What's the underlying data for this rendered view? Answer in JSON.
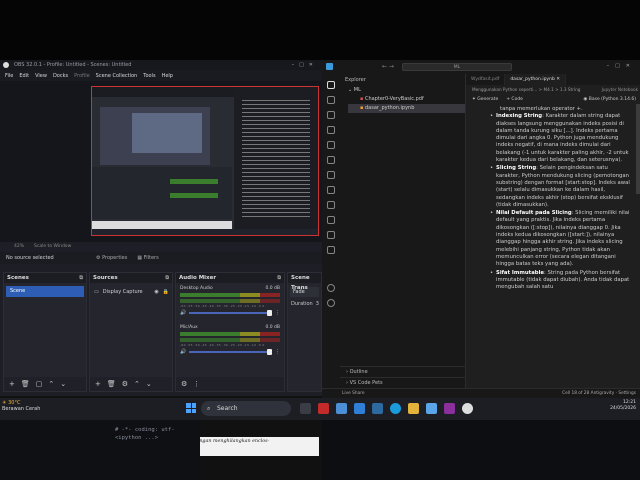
{
  "obs": {
    "title": "OBS 32.0.1 - Profile: Untitled - Scenes: Untitled",
    "menu": [
      "File",
      "Edit",
      "View",
      "Docks",
      "Profile",
      "Scene Collection",
      "Tools",
      "Help"
    ],
    "zoom": "42%",
    "scale_mode": "Scale to Window",
    "no_source": "No source selected",
    "properties_label": "Properties",
    "filters_label": "Filters",
    "docks": {
      "scenes_title": "Scenes",
      "scene_item": "Scene",
      "sources_title": "Sources",
      "source_item": "Display Capture",
      "mixer_title": "Audio Mixer",
      "channels": [
        {
          "name": "Desktop Audio",
          "db": "0.0 dB"
        },
        {
          "name": "Mic/Aux",
          "db": "0.0 dB"
        }
      ],
      "meter_ticks": "-60 -55 -50 -45 -40 -35 -30 -25 -20 -15 -10 -5 0",
      "transitions_title": "Scene Trans",
      "transition": "Fade",
      "duration_label": "Duration",
      "duration_value": "3"
    },
    "subtitle_line1": "Fungsi print() menghasilkan output yang lebih dapat terbaca dengan menghilangkan enclos-",
    "subtitle_line2": "ing quotes dan mencetak escaped and special character."
  },
  "code_strip": {
    "line1": "# -*- coding: utf-",
    "line2": "<ipython ...>"
  },
  "taskbar": {
    "weather_temp": "30°C",
    "weather_desc": "Berawan Cerah",
    "search_placeholder": "Search",
    "clock_time": "12:21",
    "clock_date": "24/05/2026"
  },
  "vscode": {
    "search_text": "ML",
    "explorer_label": "Explorer",
    "folder": "ML",
    "files": [
      "Chapter0-VeryBasic.pdf",
      "dasar_python.ipynb"
    ],
    "outline_label": "Outline",
    "vscode_pets_label": "VS Code Pets",
    "tabs": [
      "Wydfasit.pdf",
      "dasar_python.ipynb"
    ],
    "breadcrumb": "Menggunakan Python seperti... > M4.1 > 1.3 String",
    "kernel_breadcrumb": "Jupyter Notebook",
    "generate_label": "Generate",
    "code_label": "+ Code",
    "kernel": "Base (Python 3.14.6)",
    "intro": "tanpa memerlukan operator +.",
    "bullets": [
      {
        "title": "Indexing String",
        "text": ": Karakter dalam string dapat diakses langsung menggunakan indeks posisi di dalam tanda kurung siku [...]. Indeks pertama dimulai dari angka 0. Python juga mendukung indeks negatif, di mana indeks dimulai dari belakang (-1 untuk karakter paling akhir, -2 untuk karakter kedua dari belakang, dan seterusnya)."
      },
      {
        "title": "Slicing String",
        "text": ": Selain pengindeksan satu karakter, Python mendukung slicing (pemotongan substring) dengan format [start:stop]. Indeks awal (start) selalu dimasukkan ke dalam hasil, sedangkan indeks akhir (stop) bersifat eksklusif (tidak dimasukkan)."
      },
      {
        "title": "Nilai Default pada Slicing",
        "text": ": Slicing memiliki nilai default yang praktis. Jika indeks pertama dikosongkan ([:stop]), nilainya dianggap 0. Jika indeks kedua dikosongkan ([start:]), nilainya dianggap hingga akhir string. Jika indeks slicing melebihi panjang string, Python tidak akan memunculkan error (secara elegan ditangani hingga batas teks yang ada)."
      },
      {
        "title": "Sifat Immutable",
        "text": ": String pada Python bersifat immutable (tidak dapat diubah). Anda tidak dapat mengubah salah satu"
      }
    ],
    "status_left": "Live Share",
    "status_right": "Cell 18 of 28   Antigravity · Settings"
  },
  "colors": {
    "obs_bg": "#1e1f26",
    "scene_selected": "#2d5db5",
    "vscode_bg": "#1f1f1f",
    "accent_blue": "#3c99dc"
  }
}
